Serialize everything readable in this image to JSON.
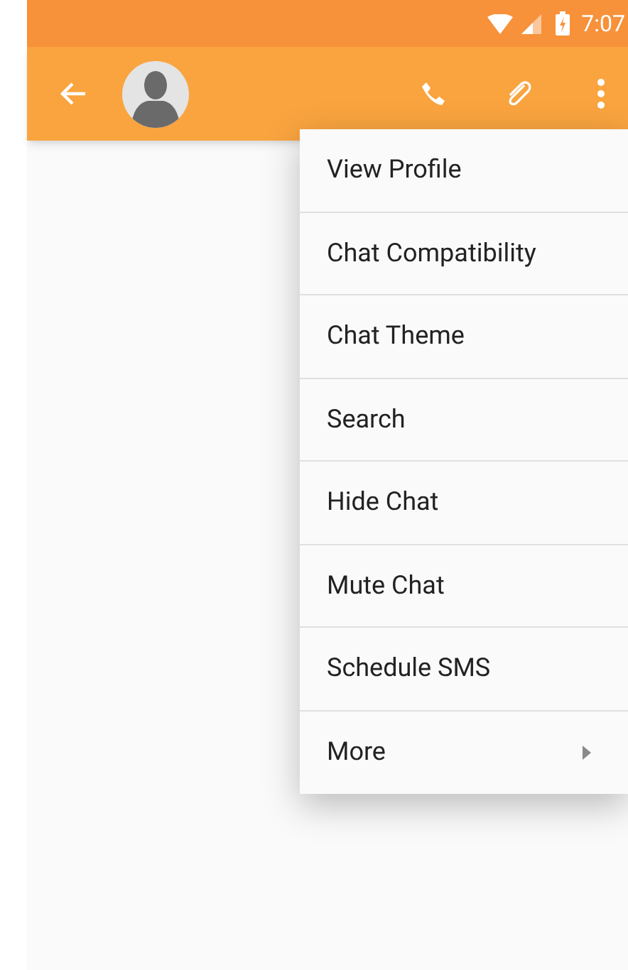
{
  "status_bar": {
    "time": "7:07"
  },
  "menu": {
    "items": [
      {
        "label": "View Profile",
        "kind": "item"
      },
      {
        "label": "Chat Compatibility",
        "kind": "item"
      },
      {
        "label": "Chat Theme",
        "kind": "item"
      },
      {
        "label": "Search",
        "kind": "item"
      },
      {
        "label": "Hide Chat",
        "kind": "item"
      },
      {
        "label": "Mute Chat",
        "kind": "item"
      },
      {
        "label": "Schedule SMS",
        "kind": "item"
      },
      {
        "label": "More",
        "kind": "submenu"
      }
    ]
  }
}
